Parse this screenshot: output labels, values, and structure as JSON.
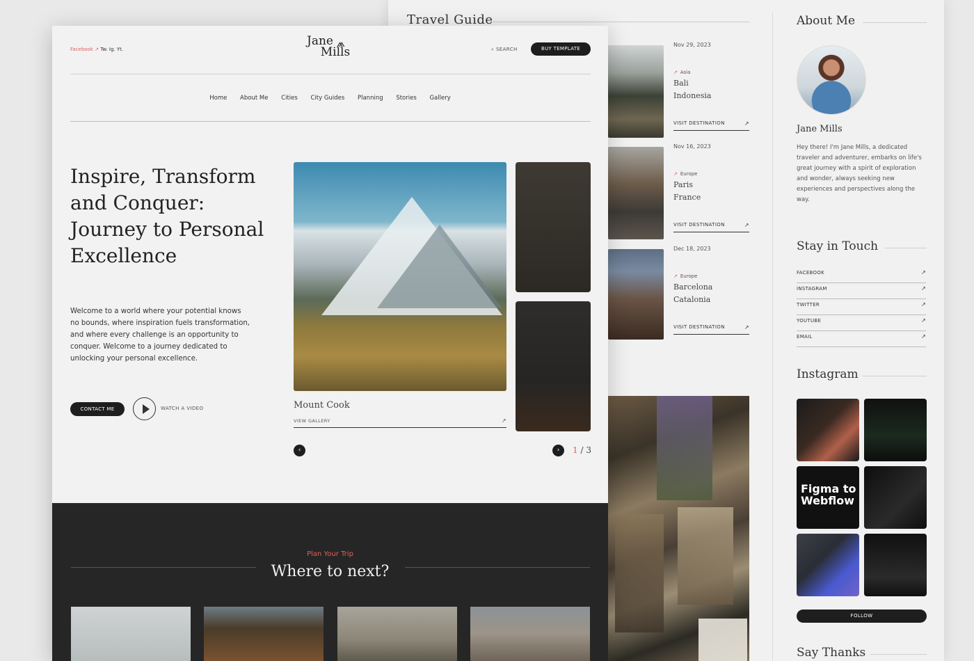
{
  "travel_guide": {
    "title": "Travel Guide",
    "destinations": [
      {
        "date": "Nov 29, 2023",
        "region": "Asia",
        "city": "Bali",
        "country": "Indonesia",
        "link": "VISIT DESTINATION"
      },
      {
        "date": "Nov 16, 2023",
        "region": "Europe",
        "city": "Paris",
        "country": "France",
        "link": "VISIT DESTINATION"
      },
      {
        "date": "Dec 18, 2023",
        "region": "Europe",
        "city": "Barcelona",
        "country": "Catalonia",
        "link": "VISIT DESTINATION"
      }
    ]
  },
  "sidebar": {
    "about_title": "About Me",
    "name": "Jane Mills",
    "bio": "Hey there! I'm Jane Mills, a dedicated traveler and adventurer, embarks on life's great journey with a spirit of exploration and wonder, always seeking new experiences and perspectives along the way.",
    "stay_title": "Stay in Touch",
    "social": [
      "FACEBOOK",
      "INSTAGRAM",
      "TWITTER",
      "YOUTUBE",
      "EMAIL"
    ],
    "instagram_title": "Instagram",
    "insta_text": "Figma to Webflow",
    "follow_label": "FOLLOW",
    "say_thanks": "Say Thanks"
  },
  "header": {
    "social_text_red": "Facebook",
    "social_text_rest": "Tw.  Ig.  Yt.",
    "logo_line1": "Jane",
    "logo_line2": "Mills",
    "search_label": "SEARCH",
    "buy_label": "BUY TEMPLATE"
  },
  "nav": [
    "Home",
    "About Me",
    "Cities",
    "City Guides",
    "Planning",
    "Stories",
    "Gallery"
  ],
  "hero": {
    "title": "Inspire, Transform and Conquer: Journey to Personal Excellence",
    "body": "Welcome to a world where your potential knows no bounds, where inspiration fuels transformation, and where every challenge is an opportunity to conquer. Welcome to a journey dedicated to unlocking your personal excellence.",
    "contact_label": "CONTACT ME",
    "watch_label": "WATCH A VIDEO"
  },
  "slider": {
    "caption": "Mount Cook",
    "view_label": "VIEW GALLERY",
    "current": "1",
    "total": "3"
  },
  "plan": {
    "kicker": "Plan Your Trip",
    "heading": "Where to next?"
  },
  "colors": {
    "accent": "#e0605a",
    "dark": "#262626",
    "bg": "#f2f2f2"
  }
}
